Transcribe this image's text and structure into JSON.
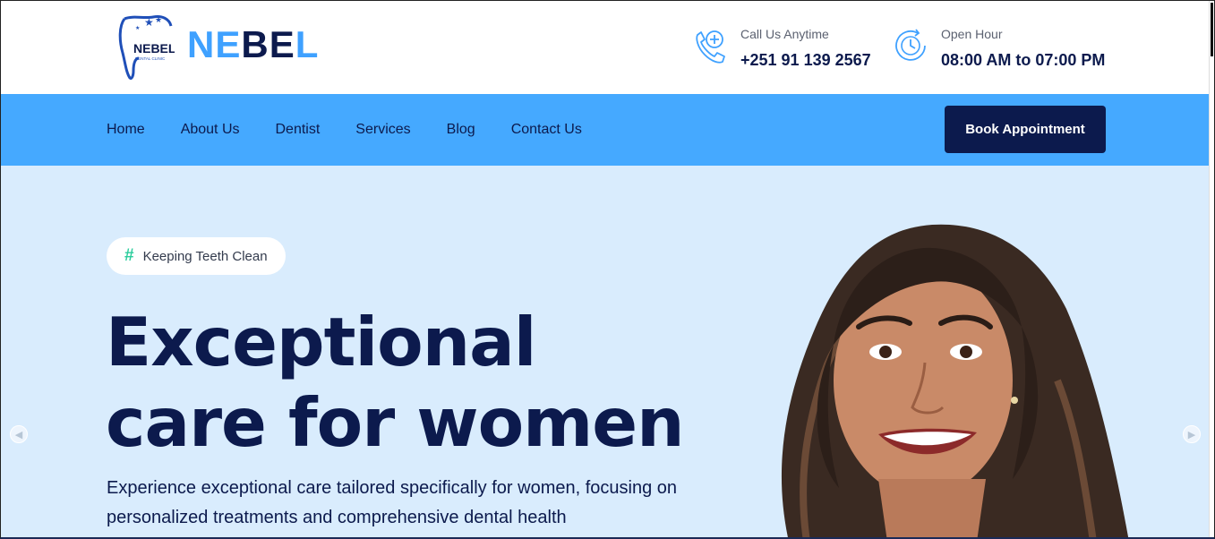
{
  "brand": {
    "part1": "NE",
    "part2": "BE",
    "part3": "L",
    "logo_text": "NEBEL",
    "logo_sub": "DENTAL CLINIC"
  },
  "contact": {
    "label": "Call Us Anytime",
    "value": "+251 91 139 2567",
    "icon": "phone-plus-icon"
  },
  "hours": {
    "label": "Open Hour",
    "value": "08:00 AM to 07:00 PM",
    "icon": "clock-icon"
  },
  "nav": {
    "items": [
      "Home",
      "About Us",
      "Dentist",
      "Services",
      "Blog",
      "Contact Us"
    ],
    "cta": "Book Appointment"
  },
  "hero": {
    "tag_symbol": "#",
    "tag": "Keeping Teeth Clean",
    "headline_line1": "Exceptional",
    "headline_line2": "care for women",
    "description": "Experience exceptional care tailored specifically for women, focusing on personalized treatments and comprehensive dental health"
  },
  "colors": {
    "navy": "#0c1a4d",
    "blue": "#45a9ff",
    "light_blue": "#d9ecfd",
    "accent_green": "#2ccd9d"
  }
}
